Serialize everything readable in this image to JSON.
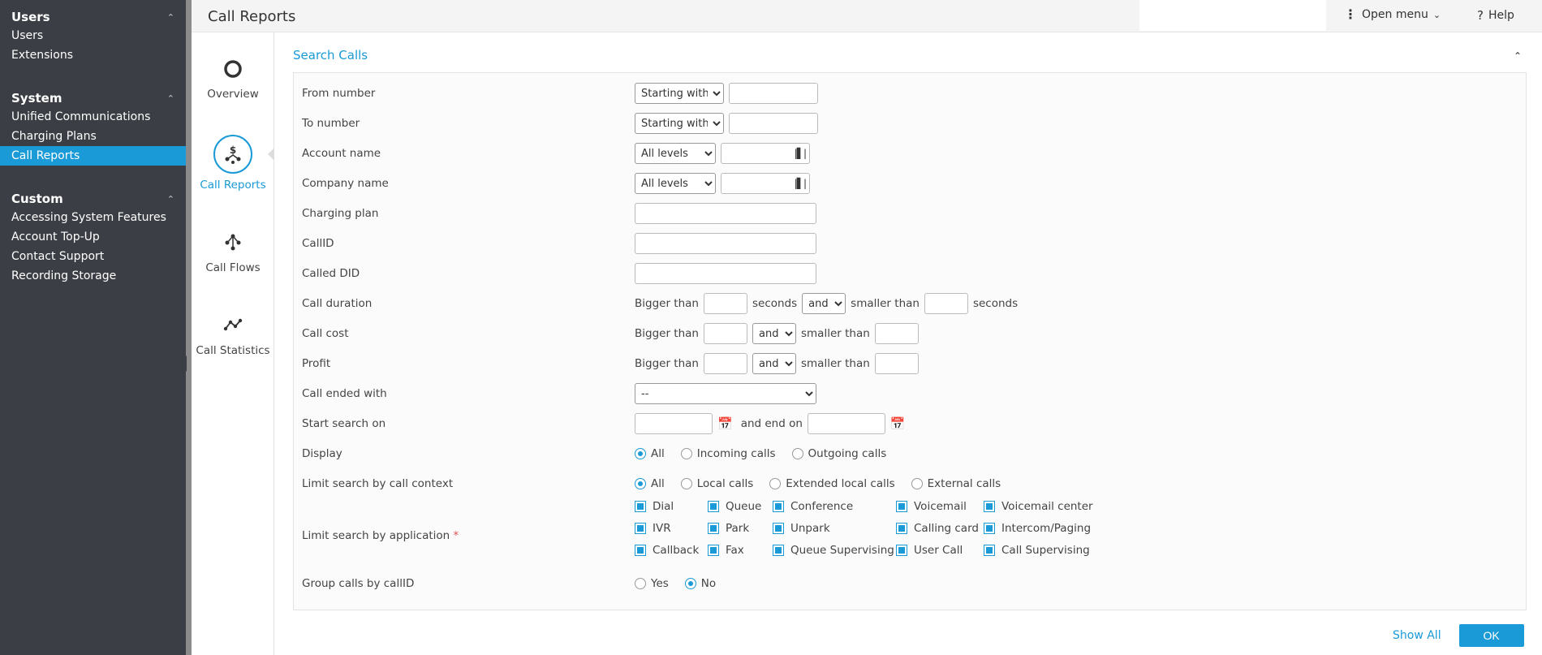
{
  "sidebar": {
    "sections": [
      {
        "title": "Users",
        "items": [
          "Users",
          "Extensions"
        ]
      },
      {
        "title": "System",
        "items": [
          "Unified Communications",
          "Charging Plans",
          "Call Reports"
        ]
      },
      {
        "title": "Custom",
        "items": [
          "Accessing System Features",
          "Account Top-Up",
          "Contact Support",
          "Recording Storage"
        ]
      }
    ],
    "active_item": "Call Reports"
  },
  "topbar": {
    "title": "Call Reports",
    "open_menu": "Open menu",
    "help": "Help"
  },
  "nav": {
    "overview": "Overview",
    "call_reports": "Call Reports",
    "call_flows": "Call Flows",
    "call_statistics": "Call Statistics"
  },
  "panel": {
    "title": "Search Calls"
  },
  "form": {
    "from_number": {
      "label": "From number",
      "match": "Starting with",
      "value": ""
    },
    "to_number": {
      "label": "To number",
      "match": "Starting with",
      "value": ""
    },
    "account_name": {
      "label": "Account name",
      "level": "All levels",
      "value": ""
    },
    "company_name": {
      "label": "Company name",
      "level": "All levels",
      "value": ""
    },
    "charging_plan": {
      "label": "Charging plan",
      "value": ""
    },
    "callid": {
      "label": "CallID",
      "value": ""
    },
    "called_did": {
      "label": "Called DID",
      "value": ""
    },
    "call_duration": {
      "label": "Call duration",
      "bigger": "Bigger than",
      "seconds": "seconds",
      "conj": "and",
      "smaller": "smaller than"
    },
    "call_cost": {
      "label": "Call cost",
      "bigger": "Bigger than",
      "conj": "and",
      "smaller": "smaller than"
    },
    "profit": {
      "label": "Profit",
      "bigger": "Bigger than",
      "conj": "and",
      "smaller": "smaller than"
    },
    "call_ended_with": {
      "label": "Call ended with",
      "value": "--"
    },
    "start_search": {
      "label": "Start search on",
      "end_label": "and end on"
    },
    "display": {
      "label": "Display",
      "options": [
        "All",
        "Incoming calls",
        "Outgoing calls"
      ],
      "selected": "All"
    },
    "call_context": {
      "label": "Limit search by call context",
      "options": [
        "All",
        "Local calls",
        "Extended local calls",
        "External calls"
      ],
      "selected": "All"
    },
    "application": {
      "label": "Limit search by application",
      "required_mark": "*",
      "options": [
        "Dial",
        "Queue",
        "Conference",
        "Voicemail",
        "Voicemail center",
        "IVR",
        "Park",
        "Unpark",
        "Calling card",
        "Intercom/Paging",
        "Callback",
        "Fax",
        "Queue Supervising",
        "User Call",
        "Call Supervising"
      ]
    },
    "group_calls": {
      "label": "Group calls by callID",
      "options": [
        "Yes",
        "No"
      ],
      "selected": "No"
    }
  },
  "actions": {
    "show_all": "Show All",
    "ok": "OK"
  },
  "colors": {
    "accent": "#1a9ad6",
    "sidebar_bg": "#3b3f45"
  }
}
